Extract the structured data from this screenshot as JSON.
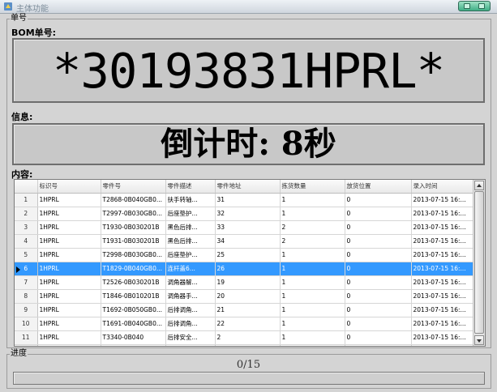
{
  "window": {
    "title": "主体功能"
  },
  "groups": {
    "top": "单号",
    "bottom": "进度"
  },
  "bom": {
    "label": "BOM单号:",
    "value": "*30193831HPRL*"
  },
  "info": {
    "label": "信息:",
    "value": "倒计时: 8秒"
  },
  "content": {
    "label": "内容:"
  },
  "table": {
    "columns": [
      "标识号",
      "零件号",
      "零件描述",
      "零件地址",
      "拣货数量",
      "放货位置",
      "录入时间"
    ],
    "rows": [
      {
        "num": "1",
        "cells": [
          "1HPRL",
          "T2868-0B040GB0...",
          "扶手转轴...",
          "31",
          "1",
          "0",
          "2013-07-15 16:..."
        ]
      },
      {
        "num": "2",
        "cells": [
          "1HPRL",
          "T2997-0B030GB0...",
          "后座垫护...",
          "32",
          "1",
          "0",
          "2013-07-15 16:..."
        ]
      },
      {
        "num": "3",
        "cells": [
          "1HPRL",
          "T1930-0B030201B",
          "黑色后排...",
          "33",
          "2",
          "0",
          "2013-07-15 16:..."
        ]
      },
      {
        "num": "4",
        "cells": [
          "1HPRL",
          "T1931-0B030201B",
          "黑色后排...",
          "34",
          "2",
          "0",
          "2013-07-15 16:..."
        ]
      },
      {
        "num": "5",
        "cells": [
          "1HPRL",
          "T2998-0B030GB0...",
          "后座垫护...",
          "25",
          "1",
          "0",
          "2013-07-15 16:..."
        ]
      },
      {
        "num": "6",
        "cells": [
          "1HPRL",
          "T1829-0B040GB0...",
          "连杆盖6...",
          "26",
          "1",
          "0",
          "2013-07-15 16:..."
        ],
        "selected": true
      },
      {
        "num": "7",
        "cells": [
          "1HPRL",
          "T2526-0B030201B",
          "调角器解...",
          "19",
          "1",
          "0",
          "2013-07-15 16:..."
        ]
      },
      {
        "num": "8",
        "cells": [
          "1HPRL",
          "T1846-0B010201B",
          "调角器手...",
          "20",
          "1",
          "0",
          "2013-07-15 16:..."
        ]
      },
      {
        "num": "9",
        "cells": [
          "1HPRL",
          "T1692-0B050GB0...",
          "后排调角...",
          "21",
          "1",
          "0",
          "2013-07-15 16:..."
        ]
      },
      {
        "num": "10",
        "cells": [
          "1HPRL",
          "T1691-0B040GB0...",
          "后排调角...",
          "22",
          "1",
          "0",
          "2013-07-15 16:..."
        ]
      },
      {
        "num": "11",
        "cells": [
          "1HPRL",
          "T3340-0B040",
          "后排安全...",
          "2",
          "1",
          "0",
          "2013-07-15 16:..."
        ]
      },
      {
        "num": "",
        "cells": [
          "",
          "",
          "黑色后排...",
          "",
          "",
          "",
          ""
        ]
      }
    ]
  },
  "progress": {
    "text": "0/15",
    "value": 0
  },
  "colors": {
    "selection": "#3399ff",
    "progress": "#3c9c3c"
  }
}
